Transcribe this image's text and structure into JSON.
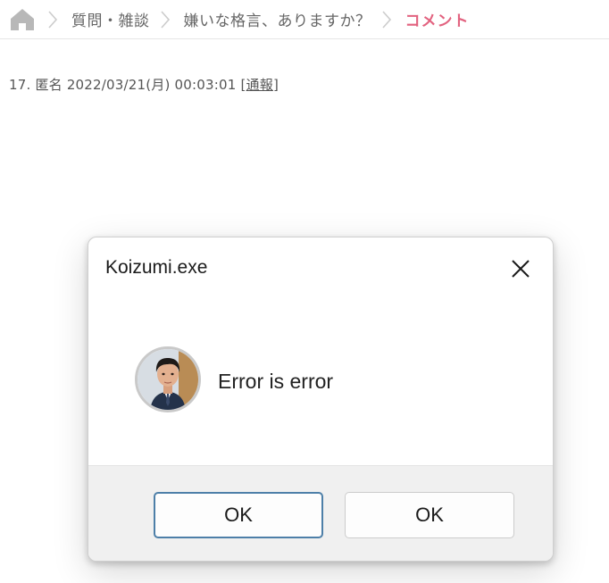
{
  "breadcrumb": {
    "items": [
      "質問・雑談",
      "嫌いな格言、ありますか？"
    ],
    "current": "コメント"
  },
  "post": {
    "number": "17.",
    "author": "匿名",
    "timestamp": "2022/03/21(月) 00:03:01",
    "report_open": "[",
    "report_label": "通報",
    "report_close": "]"
  },
  "dialog": {
    "title": "Koizumi.exe",
    "message": "Error is error",
    "buttons": [
      "OK",
      "OK"
    ]
  },
  "colors": {
    "accent": "#e2627f",
    "home_icon": "#b8b8b8",
    "primary_button_border": "#4d7fa8"
  },
  "icons": [
    "home-icon",
    "chevron-right-icon",
    "close-icon",
    "avatar"
  ]
}
